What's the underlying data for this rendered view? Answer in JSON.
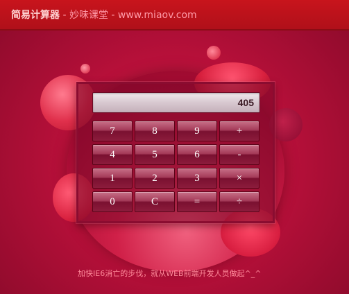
{
  "header": {
    "title": "简易计算器",
    "separator": " - ",
    "subtitle": "妙味课堂 - www.miaov.com"
  },
  "calculator": {
    "display_value": "405",
    "keys": [
      {
        "label": "7",
        "name": "key-7"
      },
      {
        "label": "8",
        "name": "key-8"
      },
      {
        "label": "9",
        "name": "key-9"
      },
      {
        "label": "+",
        "name": "key-plus"
      },
      {
        "label": "4",
        "name": "key-4"
      },
      {
        "label": "5",
        "name": "key-5"
      },
      {
        "label": "6",
        "name": "key-6"
      },
      {
        "label": "-",
        "name": "key-minus"
      },
      {
        "label": "1",
        "name": "key-1"
      },
      {
        "label": "2",
        "name": "key-2"
      },
      {
        "label": "3",
        "name": "key-3"
      },
      {
        "label": "×",
        "name": "key-multiply"
      },
      {
        "label": "0",
        "name": "key-0"
      },
      {
        "label": "C",
        "name": "key-clear"
      },
      {
        "label": "=",
        "name": "key-equals"
      },
      {
        "label": "÷",
        "name": "key-divide"
      }
    ]
  },
  "footer": {
    "text": "加快IE6消亡的步伐，就从WEB前端开发人员做起^_^"
  },
  "colors": {
    "header_bg": "#c8141c",
    "accent": "#b8103a",
    "key_text": "#ffffff"
  }
}
